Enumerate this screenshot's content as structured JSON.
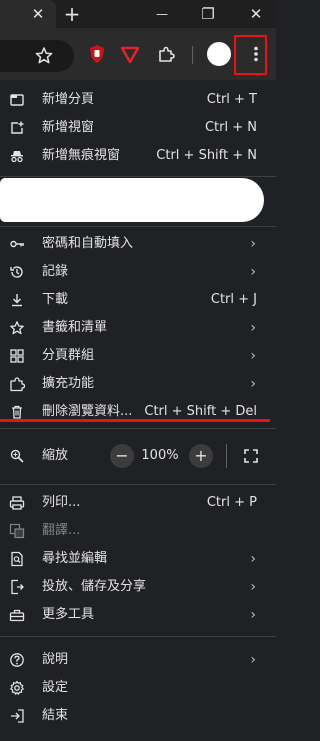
{
  "titlebar": {
    "close_tab": "✕",
    "new_tab": "+",
    "minimize": "—",
    "restore": "❐",
    "close_window": "✕"
  },
  "menu": {
    "new_tab": {
      "label": "新增分頁",
      "shortcut": "Ctrl + T"
    },
    "new_window": {
      "label": "新增視窗",
      "shortcut": "Ctrl + N"
    },
    "new_incognito": {
      "label": "新增無痕視窗",
      "shortcut": "Ctrl + Shift + N"
    },
    "passwords": {
      "label": "密碼和自動填入"
    },
    "history": {
      "label": "記錄"
    },
    "downloads": {
      "label": "下載",
      "shortcut": "Ctrl + J"
    },
    "bookmarks": {
      "label": "書籤和清單"
    },
    "tab_groups": {
      "label": "分頁群組"
    },
    "extensions": {
      "label": "擴充功能"
    },
    "clear_data": {
      "label": "刪除瀏覽資料...",
      "shortcut": "Ctrl + Shift + Del"
    },
    "zoom": {
      "label": "縮放",
      "value": "100%",
      "minus": "−",
      "plus": "+"
    },
    "print": {
      "label": "列印...",
      "shortcut": "Ctrl + P"
    },
    "translate": {
      "label": "翻譯..."
    },
    "find_edit": {
      "label": "尋找並編輯"
    },
    "cast_save_share": {
      "label": "投放、儲存及分享"
    },
    "more_tools": {
      "label": "更多工具"
    },
    "help": {
      "label": "說明"
    },
    "settings": {
      "label": "設定"
    },
    "exit": {
      "label": "結束"
    }
  },
  "colors": {
    "background": "#202124",
    "toolbar": "#2b2b2b",
    "text": "#e3e3e3",
    "highlight": "#ee1111"
  }
}
